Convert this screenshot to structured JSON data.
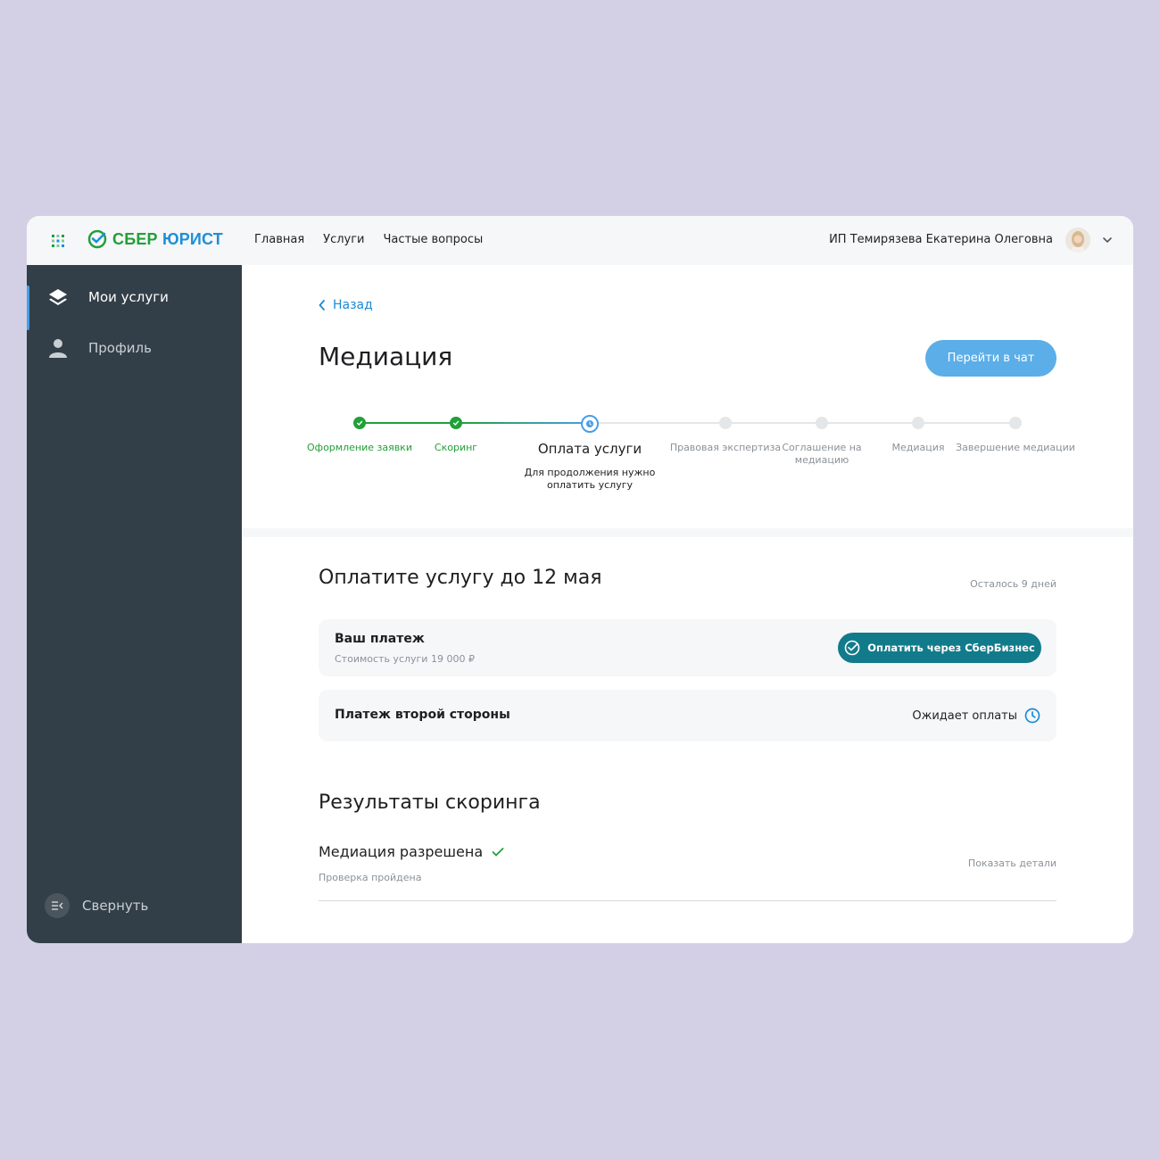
{
  "header": {
    "logo_sber": "СБЕР",
    "logo_jurist": "ЮРИСТ",
    "nav": [
      "Главная",
      "Услуги",
      "Частые вопросы"
    ],
    "user_name": "ИП Темирязева Екатерина Олеговна"
  },
  "sidebar": {
    "items": [
      {
        "label": "Мои услуги",
        "icon": "layers-icon",
        "active": true
      },
      {
        "label": "Профиль",
        "icon": "user-icon",
        "active": false
      }
    ],
    "collapse_label": "Свернуть"
  },
  "main": {
    "back_label": "Назад",
    "title": "Медиация",
    "chat_button": "Перейти в чат",
    "steps": [
      {
        "label": "Оформление заявки",
        "state": "done"
      },
      {
        "label": "Скоринг",
        "state": "done"
      },
      {
        "label": "Оплата услуги",
        "state": "current",
        "sub": "Для продолжения нужно оплатить услугу"
      },
      {
        "label": "Правовая экспертиза",
        "state": "pending"
      },
      {
        "label": "Соглашение на медиацию",
        "state": "pending"
      },
      {
        "label": "Медиация",
        "state": "pending"
      },
      {
        "label": "Завершение медиации",
        "state": "pending"
      }
    ],
    "payment": {
      "title": "Оплатите услугу до 12 мая",
      "days_left": "Осталось 9 дней",
      "your_payment_title": "Ваш платеж",
      "your_payment_sub": "Стоимость услуги 19 000 ₽",
      "pay_button": "Оплатить через СберБизнес",
      "other_payment_title": "Платеж второй стороны",
      "other_payment_status": "Ожидает оплаты"
    },
    "scoring": {
      "title": "Результаты скоринга",
      "result": "Медиация разрешена",
      "result_sub": "Проверка пройдена",
      "details_link": "Показать детали"
    }
  },
  "colors": {
    "background": "#d3d0e6",
    "sidebar": "#333f48",
    "accent_blue": "#5baee8",
    "sber_green": "#21a038",
    "pay_button": "#127b8b"
  }
}
